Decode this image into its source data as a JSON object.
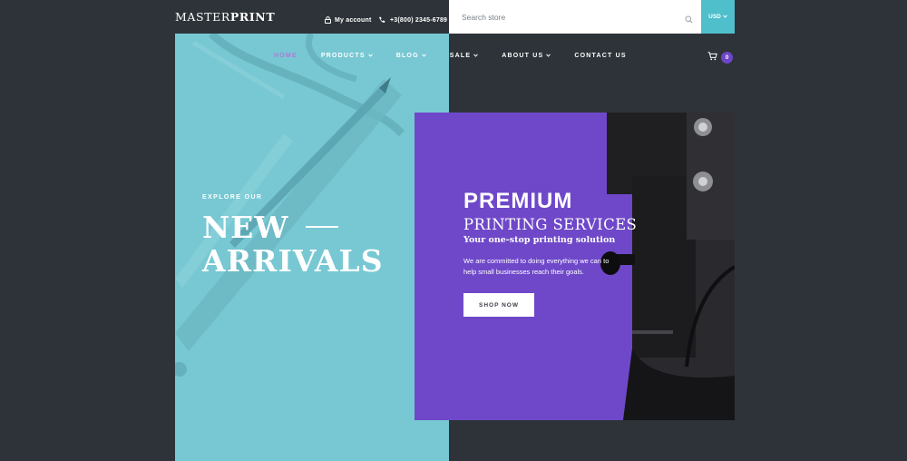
{
  "header": {
    "logo_light": "MASTER",
    "logo_bold": "PRINT",
    "account_label": "My account",
    "phone": "+3(800) 2345-6789",
    "search_placeholder": "Search store",
    "currency": "USD"
  },
  "nav": {
    "items": [
      {
        "label": "HOME",
        "active": true
      },
      {
        "label": "PRODUCTS"
      },
      {
        "label": "BLOG"
      },
      {
        "label": "SALE"
      },
      {
        "label": "ABOUT US"
      },
      {
        "label": "CONTACT US"
      }
    ],
    "cart_count": "0"
  },
  "hero": {
    "explore": "EXPLORE OUR",
    "title_line1": "NEW",
    "title_line2": "ARRIVALS"
  },
  "banner": {
    "headline": "PREMIUM",
    "subheadline": "PRINTING SERVICES",
    "tagline": "Your one-stop printing solution",
    "description": "We are committed to doing everything we can to help small businesses reach their goals.",
    "cta": "SHOP NOW"
  },
  "colors": {
    "background": "#2d3339",
    "teal": "#77c8d3",
    "accent_purple": "#6f48c9",
    "currency_bg": "#4fbfcc",
    "active_nav": "#b07ad8"
  },
  "icons": [
    "lock-icon",
    "phone-icon",
    "search-icon",
    "chevron-down-icon",
    "cart-icon"
  ]
}
